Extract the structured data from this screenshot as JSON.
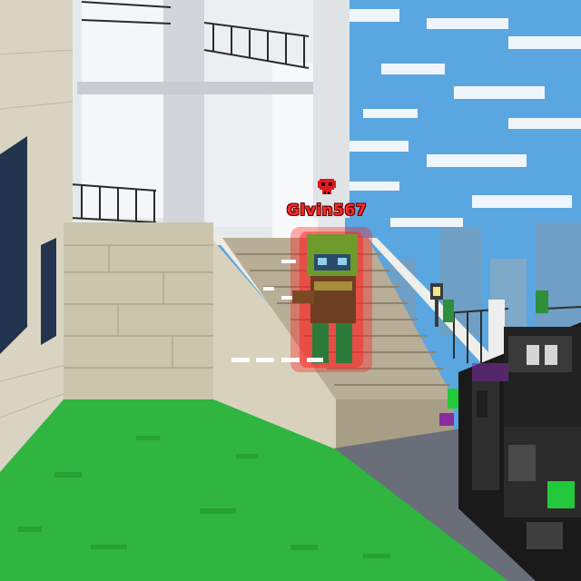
{
  "hud": {
    "enemy_name": "Glvin567",
    "enemy_marker_icon": "red-skull-icon"
  },
  "scene": {
    "sky_color": "#5aa6e0",
    "grass_color": "#2fb540",
    "wall_color": "#cfc9b5",
    "building_color": "#e8ecef",
    "enemy_highlight": "#ff1a1a",
    "weapon_accent": "#22c93a"
  }
}
